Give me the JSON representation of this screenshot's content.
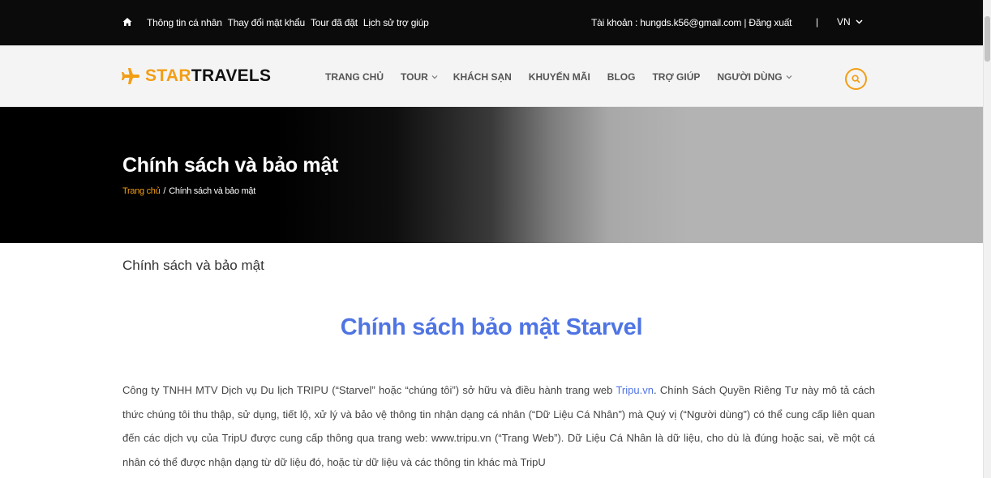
{
  "topbar": {
    "links": [
      "Thông tin cá nhân",
      "Thay đổi mật khẩu",
      "Tour đã đặt",
      "Lịch sử trợ giúp"
    ],
    "account_label": "Tài khoản : hungds.k56@gmail.com",
    "logout": "| Đăng xuất",
    "separator": "|",
    "language": "VN"
  },
  "logo": {
    "part1": "STAR",
    "part2": "TRAVELS"
  },
  "nav": {
    "items": [
      {
        "label": "TRANG CHỦ",
        "dropdown": false
      },
      {
        "label": "TOUR",
        "dropdown": true
      },
      {
        "label": "KHÁCH SẠN",
        "dropdown": false
      },
      {
        "label": "KHUYẾN MÃI",
        "dropdown": false
      },
      {
        "label": "BLOG",
        "dropdown": false
      },
      {
        "label": "TRỢ GIÚP",
        "dropdown": false
      },
      {
        "label": "NGƯỜI DÙNG",
        "dropdown": true
      }
    ]
  },
  "banner": {
    "title": "Chính sách và bảo mật",
    "breadcrumb_home": "Trang chủ",
    "breadcrumb_sep": "/",
    "breadcrumb_current": "Chính sách và bảo mật"
  },
  "content": {
    "section_title": "Chính sách và bảo mật",
    "heading": "Chính sách bảo mật Starvel",
    "para_start": "Công ty TNHH MTV Dịch vụ Du lịch TRIPU (“Starvel” hoặc “chúng tôi”) sở hữu và điều hành trang web ",
    "para_link": "Tripu.vn",
    "para_rest": ". Chính Sách Quyền Riêng Tư này mô tả cách thức chúng tôi thu thập, sử dụng, tiết lộ, xử lý và bảo vệ thông tin nhận dạng cá nhân (“Dữ Liệu Cá Nhân”) mà Quý vị (“Người dùng”) có thể cung cấp liên quan đến các dịch vụ của TripU được cung cấp thông qua trang web: www.tripu.vn (“Trang Web”). Dữ Liệu Cá Nhân là dữ liệu, cho dù là đúng hoặc sai, về một cá nhân có thể được nhận dạng từ dữ liệu đó, hoặc từ dữ liệu và các thông tin khác mà TripU"
  },
  "colors": {
    "accent": "#f29e15",
    "link": "#4f74e3",
    "topbar": "#0b0b0b"
  },
  "icons": [
    "home-icon",
    "chevron-down-icon",
    "plane-icon",
    "search-icon"
  ]
}
